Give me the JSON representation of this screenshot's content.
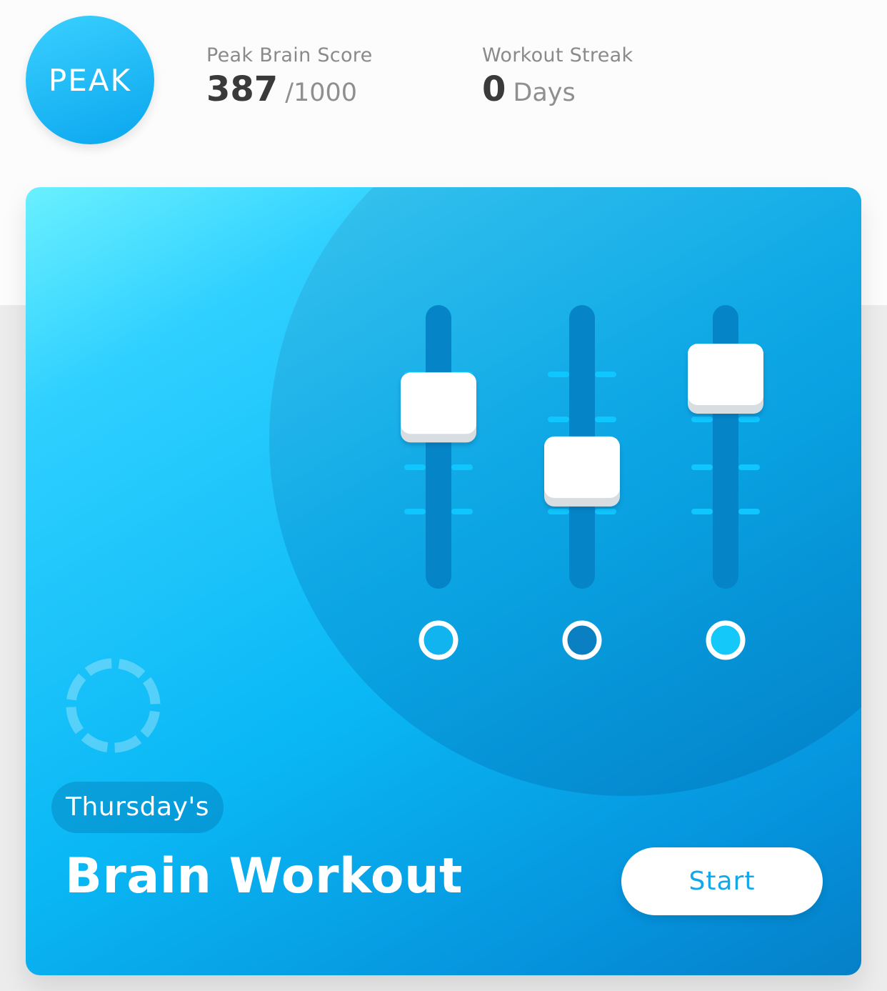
{
  "header": {
    "logo_text": "PEAK",
    "brain_score": {
      "label": "Peak Brain Score",
      "value": "387",
      "suffix": "/1000"
    },
    "workout_streak": {
      "label": "Workout Streak",
      "value": "0",
      "suffix": "Days"
    }
  },
  "card": {
    "tag": "Thursday's",
    "title": "Brain Workout",
    "start_label": "Start",
    "sliders": [
      {
        "level": 0.78,
        "indicator": "filled-light"
      },
      {
        "level": 0.29,
        "indicator": "filled-dark"
      },
      {
        "level": 1.0,
        "indicator": "filled-cyan"
      }
    ]
  },
  "colors": {
    "accent": "#12a8ea",
    "card_light": "#6af0ff",
    "card_dark": "#0580c7",
    "text_dark": "#3a3a3a",
    "text_muted": "#8a8a8a"
  }
}
